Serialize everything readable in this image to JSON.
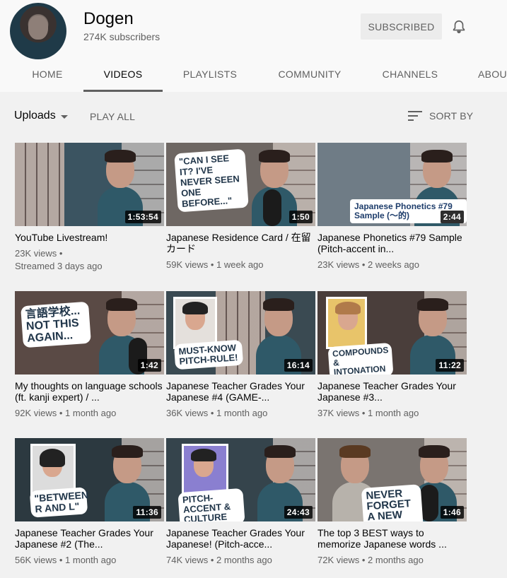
{
  "channel": {
    "name": "Dogen",
    "subscribers": "274K subscribers",
    "subscribe_label": "SUBSCRIBED",
    "avatar_icon": "avatar",
    "bell_icon": "bell-icon"
  },
  "tabs": [
    {
      "label": "HOME"
    },
    {
      "label": "VIDEOS",
      "active": true
    },
    {
      "label": "PLAYLISTS"
    },
    {
      "label": "COMMUNITY"
    },
    {
      "label": "CHANNELS"
    },
    {
      "label": "ABOU"
    }
  ],
  "toolbar": {
    "uploads_label": "Uploads",
    "play_all_label": "PLAY ALL",
    "sort_label": "SORT BY",
    "sort_icon": "sort-icon",
    "caret_icon": "caret-down-icon"
  },
  "videos": [
    {
      "title": "YouTube Livestream!",
      "views": "23K views •",
      "time": "Streamed 3 days ago",
      "duration": "1:53:54"
    },
    {
      "title": "Japanese Residence Card / 在留カード",
      "views": "59K views • 1 week ago",
      "time": "",
      "duration": "1:50",
      "callout": "\"CAN I SEE IT? I'VE NEVER SEEN ONE BEFORE...\""
    },
    {
      "title": "Japanese Phonetics #79 Sample (Pitch-accent in...",
      "views": "23K views • 2 weeks ago",
      "time": "",
      "duration": "2:44",
      "callout": "Japanese Phonetics #79 Sample (〜的)"
    },
    {
      "title": "My thoughts on language schools (ft. kanji expert) / ...",
      "views": "92K views • 1 month ago",
      "time": "",
      "duration": "1:42",
      "callout": "言語学校... NOT THIS AGAIN..."
    },
    {
      "title": "Japanese Teacher Grades Your Japanese #4 (GAME-...",
      "views": "36K views • 1 month ago",
      "time": "",
      "duration": "16:14",
      "callout": "MUST-KNOW PITCH-RULE!"
    },
    {
      "title": "Japanese Teacher Grades Your Japanese #3...",
      "views": "37K views • 1 month ago",
      "time": "",
      "duration": "11:22",
      "callout": "COMPOUNDS & INTONATION"
    },
    {
      "title": "Japanese Teacher Grades Your Japanese #2 (The...",
      "views": "56K views • 1 month ago",
      "time": "",
      "duration": "11:36",
      "callout": "\"BETWEEN R AND L\""
    },
    {
      "title": "Japanese Teacher Grades Your Japanese! (Pitch-acce...",
      "views": "74K views • 2 months ago",
      "time": "",
      "duration": "24:43",
      "callout": "PITCH-ACCENT & CULTURE"
    },
    {
      "title": "The top 3 BEST ways to memorize Japanese words ...",
      "views": "72K views • 2 months ago",
      "time": "",
      "duration": "1:46",
      "callout": "NEVER FORGET A NEW WORD"
    }
  ]
}
